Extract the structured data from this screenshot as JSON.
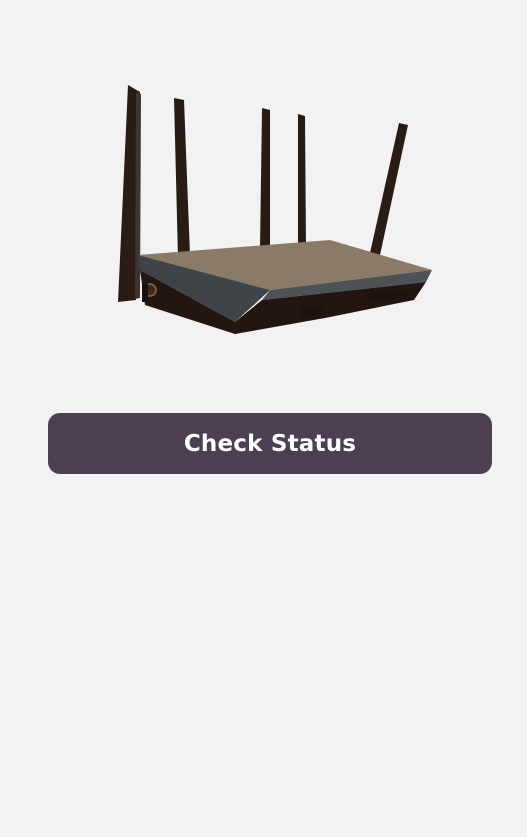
{
  "router_image": {
    "icon": "wifi-router-illustration",
    "colors": {
      "antenna": "#2a1c15",
      "top": "#8a7a68",
      "front": "#3e4448",
      "body": "#231610"
    }
  },
  "check_status_button": {
    "label": "Check Status",
    "background": "#4b3f51",
    "text_color": "#ffffff"
  }
}
